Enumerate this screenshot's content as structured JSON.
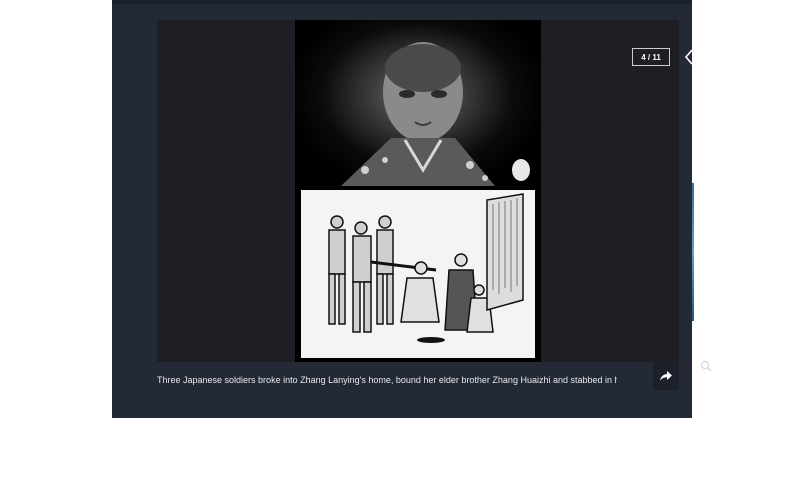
{
  "gallery": {
    "counter": "4 / 11",
    "caption": "Three Japanese soldiers broke into Zhang Lanying's home, bound her elder brother Zhang Huaizhi and stabbed in his...",
    "prev_icon": "chevron-left-icon",
    "next_icon": "chevron-right-icon",
    "zoom_icon": "search-icon",
    "share_icon": "share-icon"
  },
  "colors": {
    "panel": "#232a36",
    "stage": "#1d1f24",
    "caption_text": "#e6e8ec"
  }
}
